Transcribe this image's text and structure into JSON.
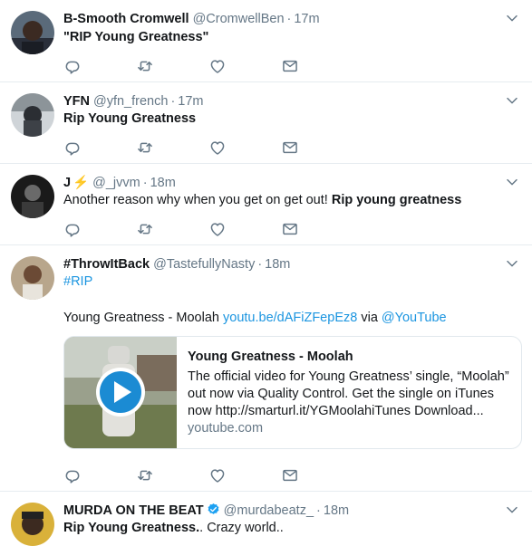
{
  "tweets": [
    {
      "name": "B-Smooth Cromwell",
      "handle": "@CromwellBen",
      "time": "17m",
      "text": "\"RIP Young Greatness\""
    },
    {
      "name": "YFN",
      "handle": "@yfn_french",
      "time": "17m",
      "text": "Rip Young Greatness"
    },
    {
      "name": "J",
      "name_emoji": "⚡",
      "handle": "@_jvvm",
      "time": "18m",
      "text_plain": "Another reason why when you get on get out! ",
      "text_bold": "Rip young greatness"
    },
    {
      "name": "#ThrowItBack",
      "handle": "@TastefullyNasty",
      "time": "18m",
      "hashtag": "#RIP",
      "text_prefix": "Young Greatness - Moolah ",
      "text_link": "youtu.be/dAFiZFepEz8",
      "text_via": " via ",
      "text_mention": "@YouTube",
      "card": {
        "title": "Young Greatness - Moolah",
        "description": "The official video for Young Greatness’ single, “Moolah” out now via Quality Control. Get the single on iTunes now http://smarturl.it/YGMoolahiTunes Download...",
        "domain": "youtube.com"
      }
    },
    {
      "name": "MURDA ON THE BEAT",
      "handle": "@murdabeatz_",
      "time": "18m",
      "text_bold": "Rip Young Greatness.",
      "text_plain": ". Crazy world.."
    }
  ],
  "separator": "·",
  "colors": {
    "link": "#1b95e0",
    "muted": "#657786",
    "divider": "#e6ecf0",
    "verified": "#1da1f2"
  },
  "icons": [
    "reply-icon",
    "retweet-icon",
    "like-icon",
    "dm-icon",
    "chevron-down-icon",
    "verified-icon",
    "play-icon"
  ]
}
